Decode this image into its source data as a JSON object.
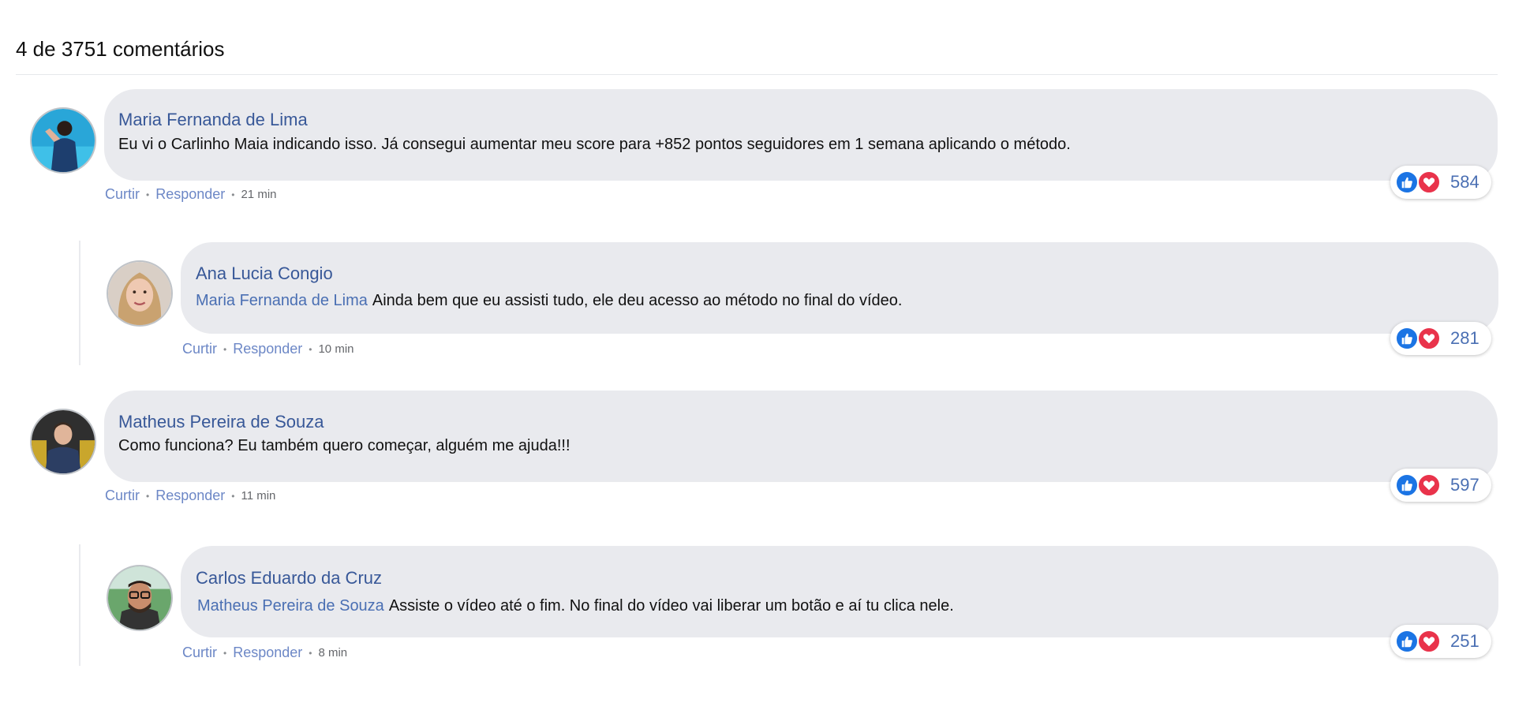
{
  "header": {
    "count_text": "4 de 3751 comentários"
  },
  "colors": {
    "bubble": "#e9eaee",
    "name": "#385898",
    "like": "#1b74e4",
    "love": "#e9334b"
  },
  "labels": {
    "like": "Curtir",
    "reply": "Responder"
  },
  "comments": [
    {
      "name": "Maria Fernanda de Lima",
      "mention": "",
      "text": "Eu vi o Carlinho Maia indicando isso. Já consegui aumentar meu score para +852 pontos seguidores em 1 semana aplicando o método.",
      "time": "21 min",
      "reactions": "584",
      "avatar": "woman-blue-avatar"
    },
    {
      "name": "Ana Lucia Congio",
      "mention": "Maria Fernanda de Lima",
      "text": "Ainda bem que eu assisti tudo, ele deu acesso ao método no final do vídeo.",
      "time": "10 min",
      "reactions": "281",
      "avatar": "blonde-woman-avatar"
    },
    {
      "name": "Matheus Pereira de Souza",
      "mention": "",
      "text": "Como funciona? Eu também quero começar, alguém me ajuda!!!",
      "time": "11 min",
      "reactions": "597",
      "avatar": "man-suit-avatar"
    },
    {
      "name": "Carlos Eduardo da Cruz",
      "mention": "Matheus Pereira de Souza",
      "text": "Assiste o vídeo até o fim. No final do vídeo vai liberar um botão e aí tu clica nele.",
      "time": "8 min",
      "reactions": "251",
      "avatar": "man-glasses-avatar"
    }
  ]
}
